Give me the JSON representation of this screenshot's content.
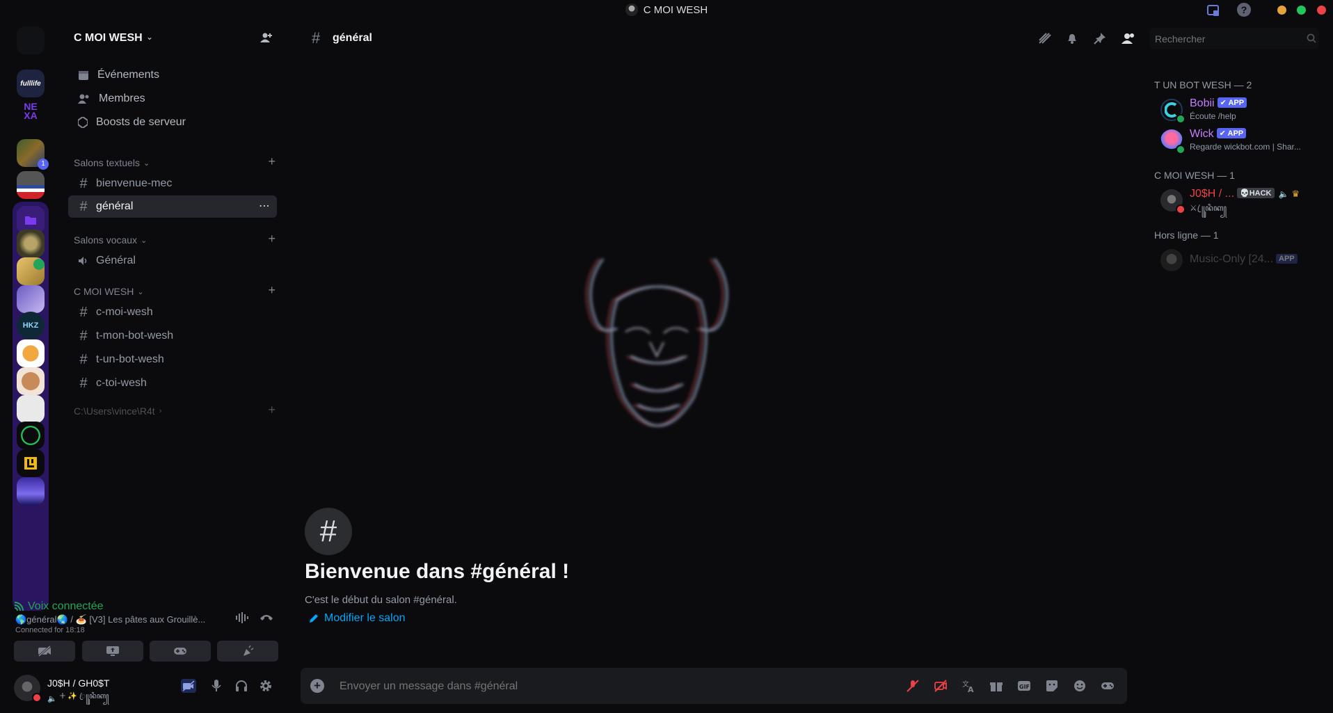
{
  "window": {
    "title": "C MOI WESH",
    "controls": {
      "minimize_color": "#e6a23c",
      "maximize_color": "#23c55e",
      "close_color": "#ed4245"
    }
  },
  "server": {
    "name": "C MOI WESH",
    "nav": [
      {
        "label": "Événements",
        "icon": "calendar-icon"
      },
      {
        "label": "Membres",
        "icon": "members-icon"
      },
      {
        "label": "Boosts de serveur",
        "icon": "boost-icon"
      }
    ],
    "categories": [
      {
        "name": "Salons textuels",
        "channels": [
          {
            "name": "bienvenue-mec"
          },
          {
            "name": "général",
            "active": true
          }
        ]
      },
      {
        "name": "Salons vocaux",
        "channels": [
          {
            "name": "Général",
            "voice": true
          }
        ]
      },
      {
        "name": "C MOI WESH",
        "channels": [
          {
            "name": "c-moi-wesh"
          },
          {
            "name": "t-mon-bot-wesh"
          },
          {
            "name": "t-un-bot-wesh"
          },
          {
            "name": "c-toi-wesh"
          }
        ]
      },
      {
        "name": "C:\\Users\\vince\\R4t",
        "channels": []
      }
    ]
  },
  "rail": {
    "servers": [
      {
        "name": "home"
      },
      {
        "name": "fulllife",
        "label": "fulllife"
      },
      {
        "name": "nexa",
        "label": "NE XA"
      },
      {
        "name": "server-group-1"
      },
      {
        "name": "server-group-2"
      },
      {
        "name": "folder"
      },
      {
        "name": "server-7"
      },
      {
        "name": "server-8"
      },
      {
        "name": "server-9"
      },
      {
        "name": "hkz",
        "label": "HKZ"
      },
      {
        "name": "server-11"
      },
      {
        "name": "server-12"
      },
      {
        "name": "server-13"
      },
      {
        "name": "server-14"
      },
      {
        "name": "server-15"
      },
      {
        "name": "server-16"
      }
    ],
    "folder_badge": "1"
  },
  "voice": {
    "status": "Voix connectée",
    "location": "🌎général🌏 / 🍝 [V3] Les pâtes aux Grouillè...",
    "connected": "Connected for 18:18"
  },
  "user": {
    "name": "J0$H / GH0$T",
    "status": "ⵜ ✨ ꦿ꧋ꦸꦤꦶꦏ꧀"
  },
  "channel": {
    "name": "général",
    "welcome_title": "Bienvenue dans #général !",
    "welcome_subtitle": "C'est le début du salon #général.",
    "edit_link": "Modifier le salon",
    "composer_placeholder": "Envoyer un message dans #général"
  },
  "search": {
    "placeholder": "Rechercher"
  },
  "members": {
    "groups": [
      {
        "title": "T UN BOT WESH — 2"
      },
      {
        "title": "C MOI WESH — 1"
      },
      {
        "title": "Hors ligne — 1"
      }
    ],
    "list": [
      {
        "name": "Bobii",
        "badge": "✔ APP",
        "status": "Écoute /help",
        "color": "#c77dff"
      },
      {
        "name": "Wick",
        "badge": "✔ APP",
        "status": "Regarde wickbot.com | Shar...",
        "color": "#c77dff"
      },
      {
        "name": "J0$H / ...",
        "badge": "💀HACK",
        "status": "⚔ ꦿ꧋ꦸꦤꦶꦏ꧀",
        "color": "#ed4245"
      },
      {
        "name": "Music-Only [24...",
        "badge": "APP",
        "status": "",
        "color": "#5c5e66"
      }
    ]
  },
  "colors": {
    "accent": "#5865f2",
    "link": "#00a8fc",
    "online": "#23a559",
    "dnd": "#ed4245",
    "voice": "#23a559"
  }
}
